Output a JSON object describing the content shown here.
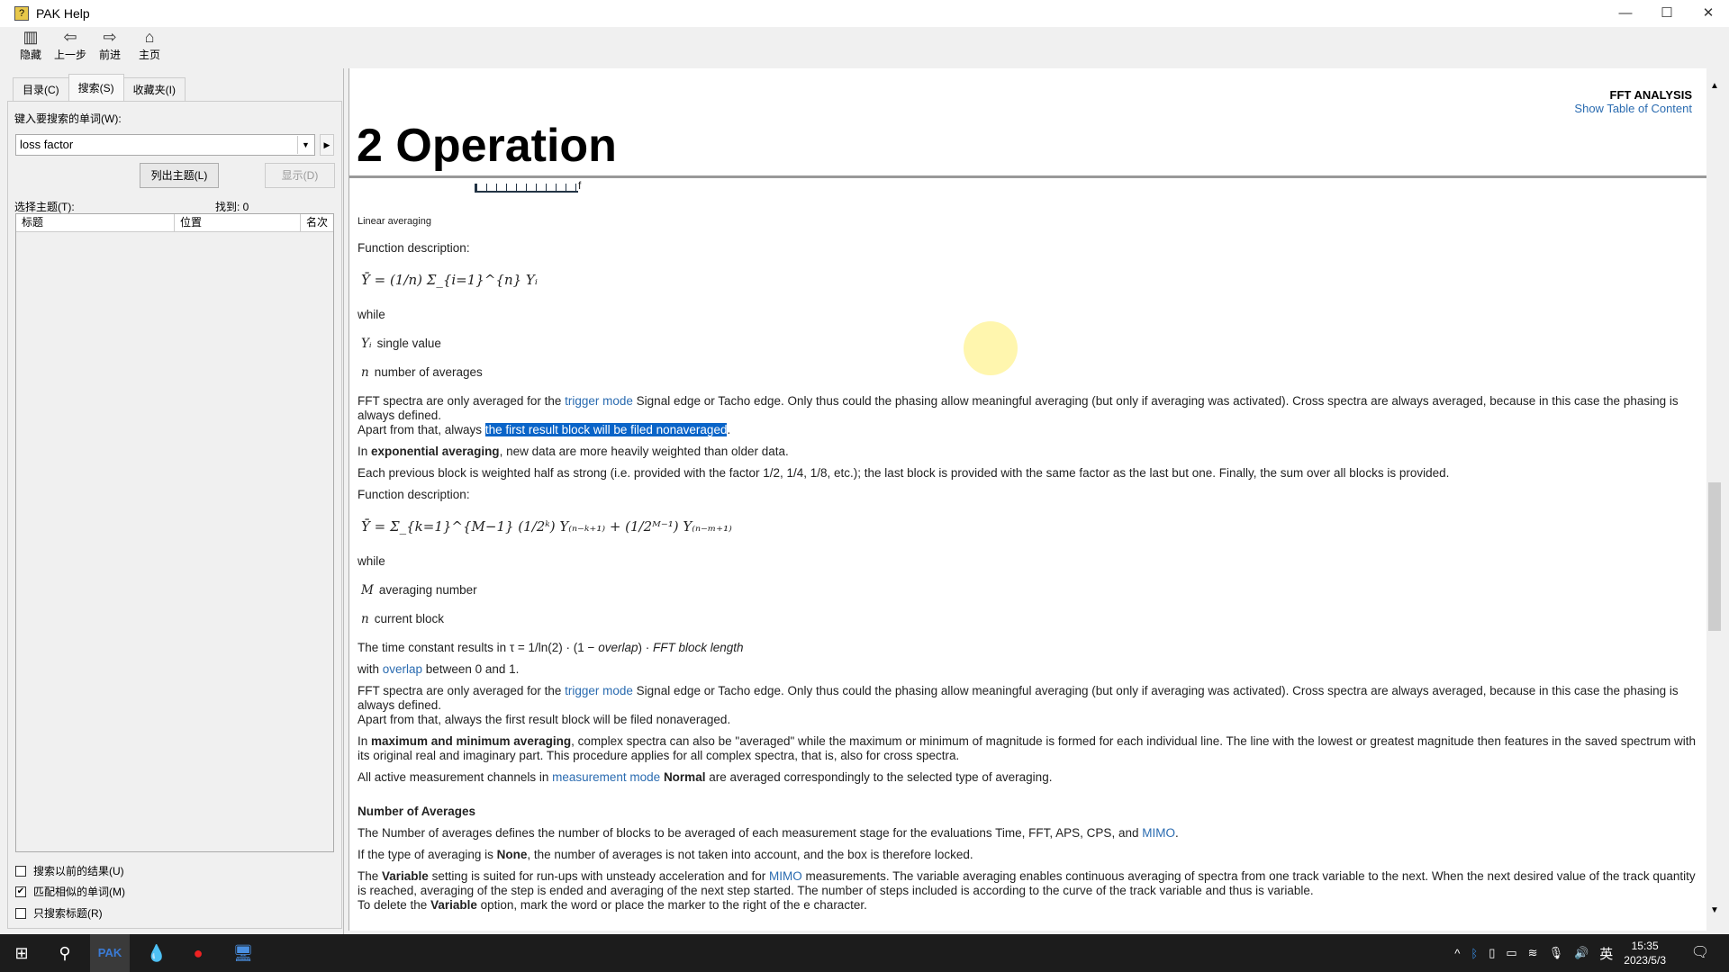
{
  "window": {
    "title": "PAK Help",
    "minimize": "—",
    "maximize": "☐",
    "close": "✕"
  },
  "toolbar": [
    {
      "label": "隐藏",
      "icon": "hide-icon",
      "glyph": "▥"
    },
    {
      "label": "上一步",
      "icon": "back-arrow-icon",
      "glyph": "⇦"
    },
    {
      "label": "前进",
      "icon": "forward-arrow-icon",
      "glyph": "⇨"
    },
    {
      "label": "主页",
      "icon": "home-icon",
      "glyph": "⌂"
    }
  ],
  "left": {
    "tabs": [
      "目录(C)",
      "搜索(S)",
      "收藏夹(I)"
    ],
    "search_label": "键入要搜索的单词(W):",
    "search_value": "loss factor",
    "list_topics": "列出主题(L)",
    "display": "显示(D)",
    "select_topic": "选择主题(T):",
    "found": "找到: 0",
    "columns": [
      "标题",
      "位置",
      "名次"
    ],
    "checkboxes": [
      {
        "label": "搜索以前的结果(U)",
        "checked": false
      },
      {
        "label": "匹配相似的单词(M)",
        "checked": true
      },
      {
        "label": "只搜索标题(R)",
        "checked": false
      }
    ]
  },
  "content": {
    "section": "FFT ANALYSIS",
    "toc_link": "Show Table of Content",
    "heading": "2 Operation",
    "axis_label": "f",
    "caption": "Linear averaging",
    "func_desc": "Function description:",
    "formula1": "Ȳ = (1/n) Σ_{i=1}^{n} Yᵢ",
    "while": "while",
    "def1": [
      {
        "sym": "Yᵢ",
        "text": "single value"
      },
      {
        "sym": "n",
        "text": "number of averages"
      }
    ],
    "p1a": "FFT spectra are only averaged for the ",
    "trigger_mode": "trigger mode",
    "p1b": " Signal edge or Tacho edge. Only thus could the phasing allow meaningful averaging (but only if averaging was activated). Cross spectra are always averaged, because in this case the phasing is always defined.",
    "p1c": "Apart from that, always ",
    "p1sel": "the first result block will be filed nonaveraged",
    "p1d": ".",
    "exp_a": "In ",
    "exp_b": "exponential averaging",
    "exp_c": ", new data are more heavily weighted than older data.",
    "each": "Each previous block is weighted half as strong (i.e. provided with the factor 1/2, 1/4, 1/8, etc.); the last block is provided with the same factor as the last but one. Finally, the sum over all blocks is provided.",
    "formula2": "Ȳ = Σ_{k=1}^{M−1} (1/2ᵏ) Y₍ₙ₋ₖ₊₁₎ + (1/2ᴹ⁻¹) Y₍ₙ₋ₘ₊₁₎",
    "def2": [
      {
        "sym": "M",
        "text": "averaging number"
      },
      {
        "sym": "n",
        "text": "current block"
      }
    ],
    "time_a": "The time constant results in τ = 1/ln(2) · (1 − ",
    "overlap_i": "overlap",
    "time_b": ") · ",
    "time_c": "FFT block length",
    "with_a": "with ",
    "overlap_link": "overlap",
    "with_b": " between 0 and 1.",
    "p2c": "Apart from that, always the first result block will be filed nonaveraged.",
    "max_a": "In ",
    "max_b": "maximum and minimum averaging",
    "max_c": ", complex spectra can also be \"averaged\" while the maximum or minimum of magnitude is formed for each individual line. The line with the lowest or greatest magnitude then features in the saved spectrum with its original real and imaginary part. This procedure applies for all complex spectra, that is, also for cross spectra.",
    "all_a": "All active measurement channels in ",
    "meas_mode": "measurement mode",
    "all_b": "Normal",
    "all_c": " are averaged correspondingly to the selected type of averaging.",
    "noa_heading": "Number of Averages",
    "noa_a": "The Number of averages defines the number of blocks to be averaged of each measurement stage for the evaluations Time, FFT, APS, CPS, and ",
    "mimo": "MIMO",
    "noa_b": ".",
    "none_a": "If the type of averaging is ",
    "none_b": "None",
    "none_c": ", the number of averages is not taken into account, and the box is therefore locked.",
    "var_a": "The ",
    "var_b": "Variable",
    "var_c": " setting is suited for run-ups with unsteady acceleration and for ",
    "var_d": " measurements. The variable averaging enables continuous averaging of spectra from one track variable to the next. When the next desired value of the track quantity is reached, averaging of the step is ended and averaging of the next step started. The number of steps included is according to the curve of the track variable and thus is variable.",
    "del_a": "To delete the ",
    "del_b": "Variable",
    "del_c": " option, mark the word or place the marker to the right of the e character."
  },
  "taskbar": {
    "time": "15:35",
    "date": "2023/5/3",
    "ime": "英",
    "apps": [
      "PAK"
    ]
  }
}
